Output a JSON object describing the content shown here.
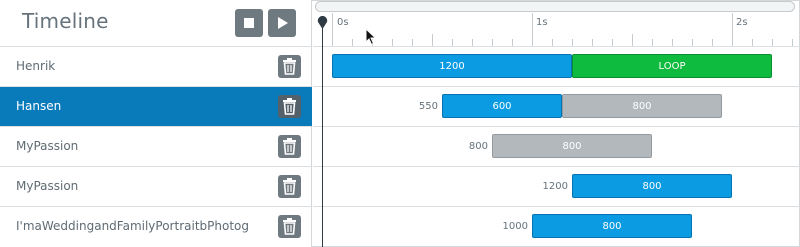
{
  "header": {
    "title": "Timeline",
    "stop_label": "Stop",
    "play_label": "Play"
  },
  "rows": [
    {
      "label": "Henrik",
      "selected": false
    },
    {
      "label": "Hansen",
      "selected": true
    },
    {
      "label": "MyPassion",
      "selected": false
    },
    {
      "label": "MyPassion",
      "selected": false
    },
    {
      "label": "I'maWeddingandFamilyPortraitbPhotog",
      "selected": false
    }
  ],
  "ruler": {
    "labels": [
      "0s",
      "1s",
      "2s"
    ]
  },
  "tracks": [
    {
      "delay": null,
      "segments": [
        {
          "label": "1200",
          "color": "blue"
        },
        {
          "label": "LOOP",
          "color": "green"
        }
      ]
    },
    {
      "delay": "550",
      "segments": [
        {
          "label": "600",
          "color": "blue"
        },
        {
          "label": "800",
          "color": "gray"
        }
      ]
    },
    {
      "delay": "800",
      "segments": [
        {
          "label": "800",
          "color": "gray"
        }
      ]
    },
    {
      "delay": "1200",
      "segments": [
        {
          "label": "800",
          "color": "blue"
        }
      ]
    },
    {
      "delay": "1000",
      "segments": [
        {
          "label": "800",
          "color": "blue"
        }
      ]
    }
  ],
  "colors": {
    "selected_row": "#0a7bba",
    "blue_bar": "#0a9be3",
    "green_bar": "#0fbb3f",
    "gray_bar": "#b3b8bc"
  },
  "icons": {
    "delete": "trash-icon",
    "stop": "stop-icon",
    "play": "play-icon",
    "playhead": "playhead-icon"
  }
}
